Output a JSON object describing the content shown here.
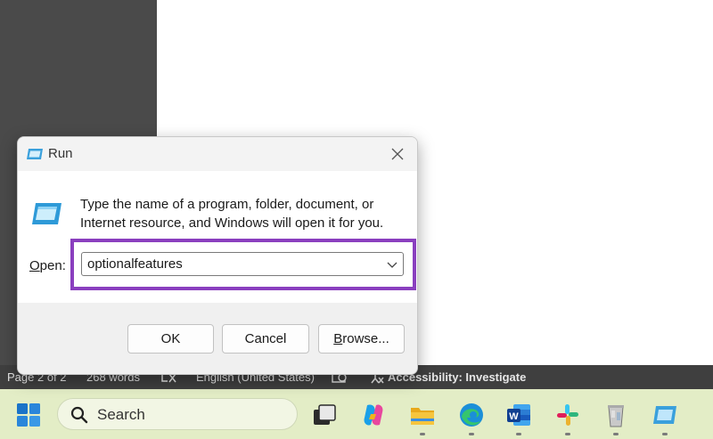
{
  "run_dialog": {
    "title": "Run",
    "description": "Type the name of a program, folder, document, or Internet resource, and Windows will open it for you.",
    "open_label_accel": "O",
    "open_label_rest": "pen:",
    "input_value": "optionalfeatures",
    "ok_label": "OK",
    "cancel_label": "Cancel",
    "browse_accel": "B",
    "browse_rest": "rowse...",
    "highlight_color": "#8a3fbf"
  },
  "statusbar": {
    "page": "Page 2 of 2",
    "words": "268 words",
    "language": "English (United States)",
    "accessibility": "Accessibility: Investigate"
  },
  "taskbar": {
    "search_placeholder": "Search",
    "background": "#e3edc6",
    "apps": [
      "start-icon",
      "task-view-icon",
      "copilot-icon",
      "file-explorer-icon",
      "edge-icon",
      "word-icon",
      "slack-icon",
      "recycle-bin-icon",
      "run-icon"
    ]
  }
}
